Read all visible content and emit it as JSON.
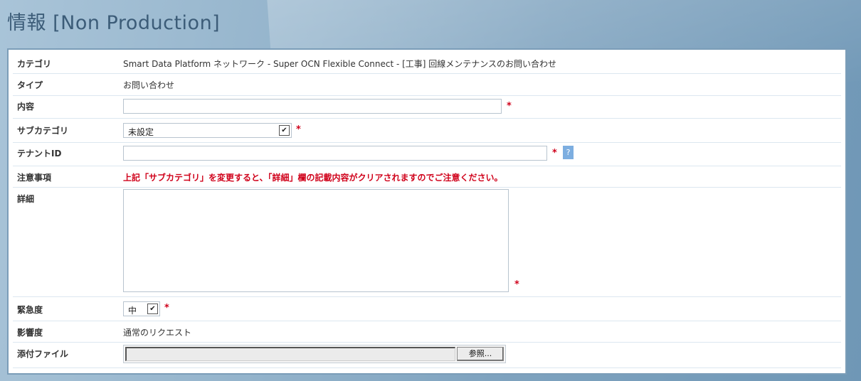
{
  "page": {
    "title": "情報 [Non Production]"
  },
  "form": {
    "category": {
      "label": "カテゴリ",
      "value": "Smart Data Platform ネットワーク - Super OCN Flexible Connect - [工事] 回線メンテナンスのお問い合わせ"
    },
    "type": {
      "label": "タイプ",
      "value": "お問い合わせ"
    },
    "content": {
      "label": "内容",
      "value": "",
      "required_mark": "*"
    },
    "subcategory": {
      "label": "サブカテゴリ",
      "selected": "未設定",
      "required_mark": "*"
    },
    "tenant_id": {
      "label": "テナントID",
      "value": "",
      "required_mark": "*",
      "help": "?"
    },
    "notice": {
      "label": "注意事項",
      "text": "上記「サブカテゴリ」を変更すると、「詳細」欄の記載内容がクリアされますのでご注意ください。"
    },
    "details": {
      "label": "詳細",
      "value": "",
      "required_mark": "*"
    },
    "urgency": {
      "label": "緊急度",
      "selected": "中",
      "required_mark": "*"
    },
    "impact": {
      "label": "影響度",
      "value": "通常のリクエスト"
    },
    "attachment": {
      "label": "添付ファイル",
      "browse_label": "参照..."
    }
  },
  "colors": {
    "required": "#d0021b",
    "title": "#3c5c78",
    "help_button": "#7daee0"
  }
}
